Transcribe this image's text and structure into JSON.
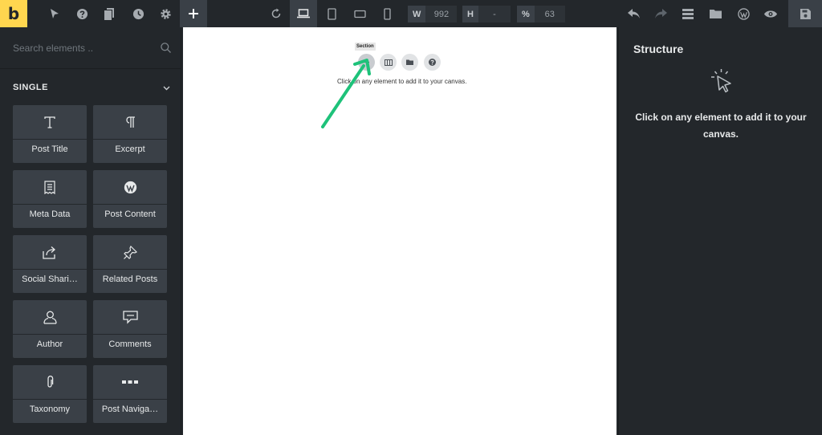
{
  "toolbar": {
    "logo": "b",
    "width": {
      "label": "W",
      "value": "992"
    },
    "height": {
      "label": "H",
      "value": "-"
    },
    "zoom": {
      "label": "%",
      "value": "63"
    }
  },
  "left_panel": {
    "search_placeholder": "Search elements ..",
    "category": "SINGLE",
    "elements": [
      {
        "label": "Post Title",
        "icon": "title-icon"
      },
      {
        "label": "Excerpt",
        "icon": "paragraph-icon"
      },
      {
        "label": "Meta Data",
        "icon": "receipt-icon"
      },
      {
        "label": "Post Content",
        "icon": "wordpress-icon"
      },
      {
        "label": "Social Shari…",
        "icon": "share-icon"
      },
      {
        "label": "Related Posts",
        "icon": "pin-icon"
      },
      {
        "label": "Author",
        "icon": "user-icon"
      },
      {
        "label": "Comments",
        "icon": "comment-icon"
      },
      {
        "label": "Taxonomy",
        "icon": "attachment-icon"
      },
      {
        "label": "Post Naviga…",
        "icon": "ellipsis-icon"
      }
    ]
  },
  "canvas": {
    "tooltip": "Section",
    "hint": "Click on any element to add it to your canvas."
  },
  "right_panel": {
    "title": "Structure",
    "message": "Click on any element to add it to your canvas."
  },
  "colors": {
    "logo_bg": "#ffd64f",
    "panel_bg": "#23272b",
    "tile_bg": "#3a4047",
    "arrow": "#1ec27a"
  }
}
